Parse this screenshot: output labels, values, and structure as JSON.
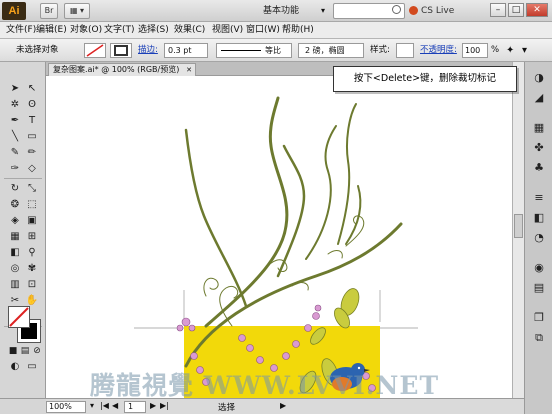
{
  "app": {
    "logo": "Ai",
    "workspace": "基本功能",
    "cs_live": "CS Live",
    "window_buttons": [
      "–",
      "□",
      "✕"
    ]
  },
  "menu": {
    "items": [
      "文件(F)",
      "编辑(E)",
      "对象(O)",
      "文字(T)",
      "选择(S)",
      "效果(C)",
      "视图(V)",
      "窗口(W)",
      "帮助(H)"
    ]
  },
  "control_bar": {
    "selection_status": "未选择对象",
    "stroke_label": "描边:",
    "stroke_value": "0.3 pt",
    "stroke_profile": "等比",
    "brush": "2 磅，椭圆",
    "style_label": "样式:",
    "opacity_label": "不透明度:",
    "opacity_value": "100",
    "opacity_unit": "%"
  },
  "document": {
    "tab_label": "复杂图案.ai* @ 100% (RGB/预览)",
    "close_glyph": "✕"
  },
  "tooltip": {
    "text": "按下<Delete>键，删除裁切标记"
  },
  "status_bar": {
    "zoom": "100%",
    "page": "1",
    "tool_name": "选择"
  },
  "watermark": {
    "text": "腾龍視覺 WWW.LVVI.NET"
  },
  "colors": {
    "vine": "#6d7a2f",
    "background_rect": "#f2d90a",
    "flower": "#c98ac6",
    "leaf": "#c7c83a",
    "bird_blue": "#2c64b0",
    "bird_orange": "#e07a2a"
  }
}
